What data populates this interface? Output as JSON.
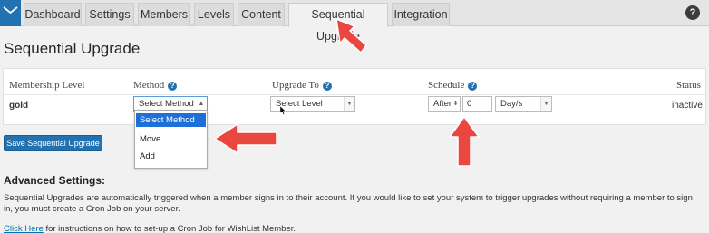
{
  "nav": {
    "tabs": [
      {
        "label": "Dashboard"
      },
      {
        "label": "Settings"
      },
      {
        "label": "Members"
      },
      {
        "label": "Levels"
      },
      {
        "label": "Content"
      },
      {
        "label": "Sequential Upgrade"
      },
      {
        "label": "Integration"
      }
    ],
    "active_tab": "Sequential Upgrade",
    "help_label": "?"
  },
  "page": {
    "title": "Sequential Upgrade"
  },
  "table": {
    "headers": {
      "membership_level": "Membership Level",
      "method": "Method",
      "upgrade_to": "Upgrade To",
      "schedule": "Schedule",
      "status": "Status"
    },
    "row": {
      "level": "gold",
      "method_value": "Select Method",
      "upgrade_value": "Select Level",
      "schedule_when": "After",
      "schedule_amount": "0",
      "schedule_unit": "Day/s",
      "status": "inactive"
    },
    "method_options": [
      {
        "label": "Select Method",
        "highlighted": true
      },
      {
        "label": "Move",
        "highlighted": false
      },
      {
        "label": "Add",
        "highlighted": false
      }
    ]
  },
  "save_button": "Save Sequential Upgrade",
  "advanced": {
    "title": "Advanced Settings:",
    "description": "Sequential Upgrades are automatically triggered when a member signs in to their account. If you would like to set your system to trigger upgrades without requiring a member to sign in, you must create a Cron Job on your server.",
    "link_text": "Click Here",
    "link_suffix": " for instructions on how to set-up a Cron Job for WishList Member."
  },
  "colors": {
    "accent": "#2271b1",
    "annotation_arrow": "#e9473f",
    "highlight": "#1e6fd9"
  }
}
